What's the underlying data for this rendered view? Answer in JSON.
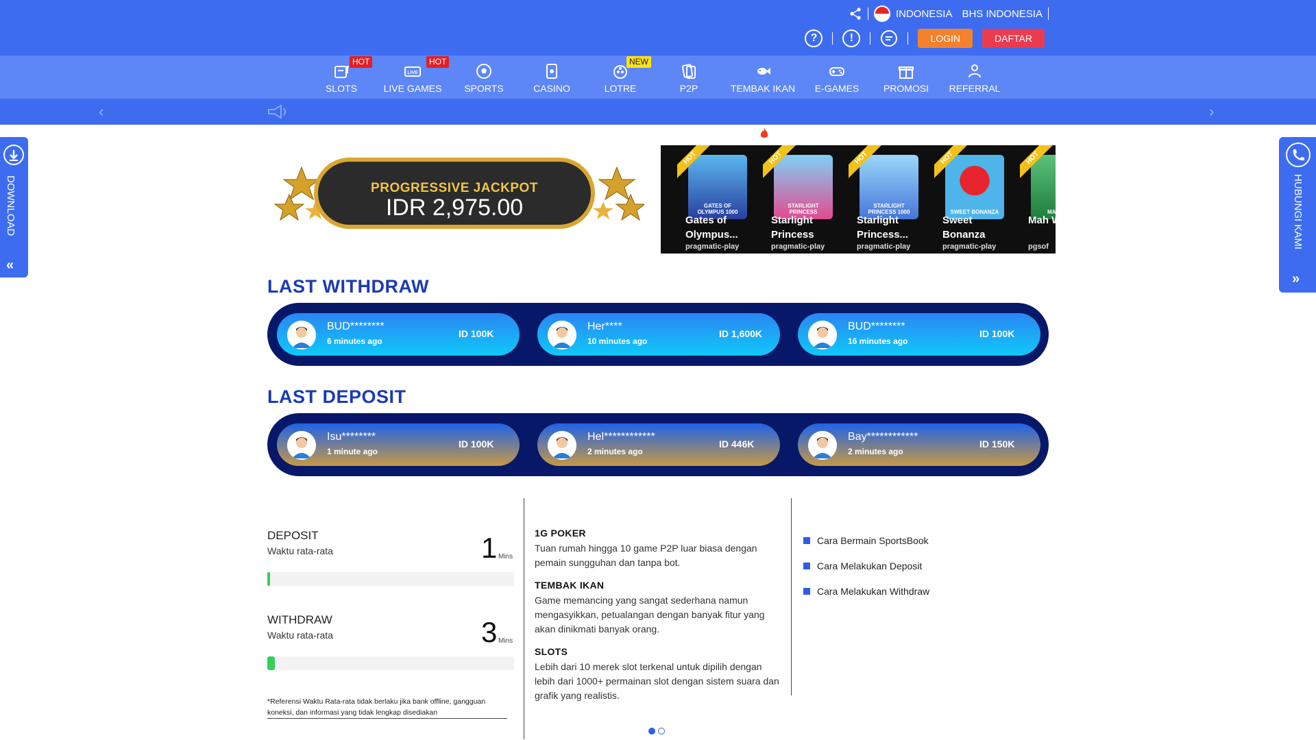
{
  "header": {
    "country": "INDONESIA",
    "language": "BHS INDONESIA",
    "login_label": "LOGIN",
    "register_label": "DAFTAR"
  },
  "nav": {
    "items": [
      {
        "label": "SLOTS",
        "icon": "slot-machine-icon",
        "badge": "HOT"
      },
      {
        "label": "LIVE GAMES",
        "icon": "live-tv-icon",
        "badge": "HOT"
      },
      {
        "label": "SPORTS",
        "icon": "soccer-ball-icon",
        "badge": ""
      },
      {
        "label": "CASINO",
        "icon": "playing-card-icon",
        "badge": ""
      },
      {
        "label": "LOTRE",
        "icon": "lottery-ball-icon",
        "badge": "NEW"
      },
      {
        "label": "P2P",
        "icon": "cards-icon",
        "badge": ""
      },
      {
        "label": "TEMBAK IKAN",
        "icon": "fish-icon",
        "badge": ""
      },
      {
        "label": "E-GAMES",
        "icon": "gamepad-icon",
        "badge": ""
      },
      {
        "label": "PROMOSI",
        "icon": "gift-icon",
        "badge": ""
      },
      {
        "label": "REFERRAL",
        "icon": "referral-icon",
        "badge": ""
      }
    ]
  },
  "side": {
    "download_label": "DOWNLOAD",
    "contact_label": "HUBUNGI KAMI"
  },
  "jackpot": {
    "title": "PROGRESSIVE JACKPOT",
    "value": "IDR 2,975.00"
  },
  "games": [
    {
      "name": "Gates of Olympus...",
      "provider": "pragmatic-play",
      "thumb_text": "GATES OF OLYMPUS 1000",
      "badge": "HOT"
    },
    {
      "name": "Starlight Princess",
      "provider": "pragmatic-play",
      "thumb_text": "STARLIGHT PRINCESS",
      "badge": "HOT"
    },
    {
      "name": "Starlight Princess...",
      "provider": "pragmatic-play",
      "thumb_text": "STARLIGHT PRINCESS 1000",
      "badge": "HOT"
    },
    {
      "name": "Sweet Bonanza",
      "provider": "pragmatic-play",
      "thumb_text": "SWEET BONANZA",
      "badge": "HOT"
    },
    {
      "name": "Mah Way",
      "provider": "pgsof",
      "thumb_text": "MAH WAY",
      "badge": "HOT"
    }
  ],
  "withdraw": {
    "title": "LAST WITHDRAW",
    "entries": [
      {
        "name": "BUD********",
        "time": "6 minutes ago",
        "amount": "ID 100K"
      },
      {
        "name": "Her****",
        "time": "10 minutes ago",
        "amount": "ID 1,600K"
      },
      {
        "name": "BUD********",
        "time": "16 minutes ago",
        "amount": "ID 100K"
      }
    ]
  },
  "deposit": {
    "title": "LAST DEPOSIT",
    "entries": [
      {
        "name": "Isu********",
        "time": "1 minute ago",
        "amount": "ID 100K"
      },
      {
        "name": "Hel************",
        "time": "2 minutes ago",
        "amount": "ID 446K"
      },
      {
        "name": "Bay************",
        "time": "2 minutes ago",
        "amount": "ID 150K"
      }
    ]
  },
  "stats": {
    "deposit": {
      "label": "DEPOSIT",
      "sub": "Waktu rata-rata",
      "value": "1",
      "unit": "Mins",
      "progress": 0.01
    },
    "withdraw": {
      "label": "WITHDRAW",
      "sub": "Waktu rata-rata",
      "value": "3",
      "unit": "Mins",
      "progress": 0.03
    },
    "note": "*Referensi Waktu Rata-rata tidak berlaku jika bank offline, gangguan koneksi, dan informasi yang tidak lengkap disediakan"
  },
  "info": [
    {
      "title": "1G POKER",
      "text": "Tuan rumah hingga 10 game P2P luar biasa dengan pemain sungguhan dan tanpa bot."
    },
    {
      "title": "TEMBAK IKAN",
      "text": "Game memancing yang sangat sederhana namun mengasyikkan, petualangan dengan banyak fitur yang akan dinikmati banyak orang."
    },
    {
      "title": "SLOTS",
      "text": "Lebih dari 10 merek slot terkenal untuk dipilih dengan lebih dari 1000+ permainan slot dengan sistem suara dan grafik yang realistis."
    }
  ],
  "links": [
    "Cara Bermain SportsBook",
    "Cara Melakukan Deposit",
    "Cara Melakukan Withdraw"
  ],
  "colors": {
    "primary": "#3d6cf0",
    "nav": "#5d86f7",
    "panel": "#081869",
    "login": "#f4822d",
    "register": "#ec3b4f",
    "title": "#1b3bb1"
  }
}
